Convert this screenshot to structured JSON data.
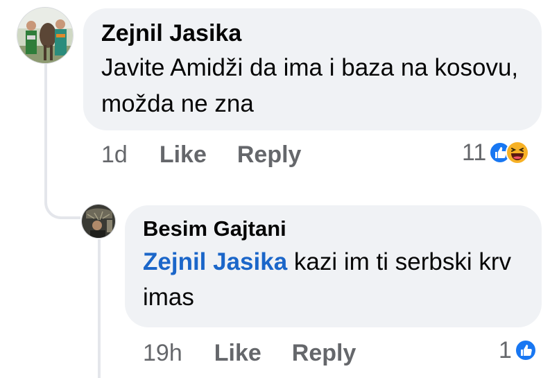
{
  "comments": [
    {
      "author": "Zejnil Jasika",
      "text": "Javite Amidži da ima i baza na kosovu, možda ne zna",
      "time": "1d",
      "like_label": "Like",
      "reply_label": "Reply",
      "reaction_count": "11",
      "reactions": [
        "like-icon",
        "haha-icon"
      ]
    }
  ],
  "replies": [
    {
      "author": "Besim Gajtani",
      "mention": "Zejnil Jasika",
      "text_after_mention": " kazi im ti serbski krv imas",
      "time": "19h",
      "like_label": "Like",
      "reply_label": "Reply",
      "reaction_count": "1",
      "reactions": [
        "like-icon"
      ]
    }
  ],
  "colors": {
    "bubble_bg": "#f0f2f5",
    "mention": "#1b66c9",
    "meta": "#65676b",
    "like_blue": "#1877f2",
    "haha_yellow": "#f7b125"
  }
}
